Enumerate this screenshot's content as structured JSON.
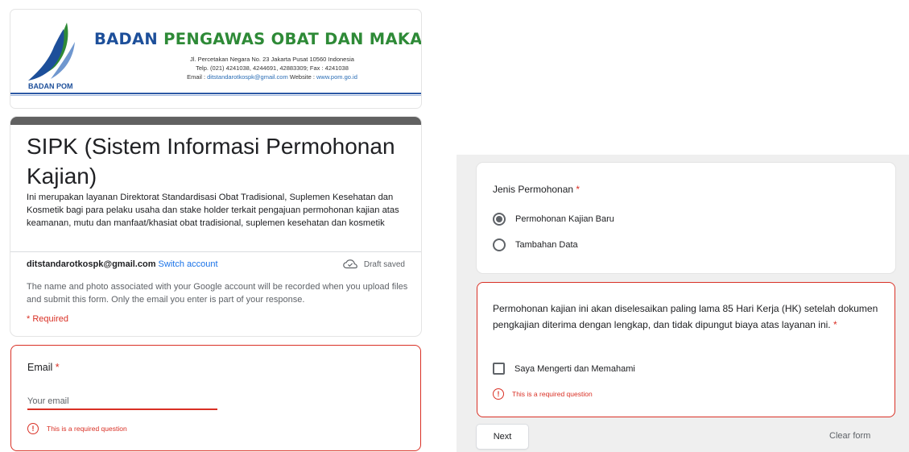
{
  "header": {
    "logo_label": "BADAN POM",
    "org_name_part1": "BADAN",
    "org_name_part2": "PENGAWAS OBAT DAN MAKANAN",
    "address_line1": "Jl. Percetakan Negara No. 23 Jakarta Pusat 10560 Indonesia",
    "address_line2": "Telp. (021) 4241038, 4244691, 42883309; Fax : 4241038",
    "address_email_label": "Email : ",
    "address_email": "ditstandarotkospk@gmail.com",
    "address_web_label": " Website : ",
    "address_web": "www.pom.go.id",
    "colors": {
      "blue": "#1d4f9a",
      "green": "#2e8a37"
    }
  },
  "form": {
    "title": "SIPK (Sistem Informasi Permohonan Kajian)",
    "description": "Ini merupakan layanan Direktorat Standardisasi Obat Tradisional, Suplemen Kesehatan dan Kosmetik bagi para pelaku usaha dan stake holder terkait pengajuan permohonan kajian atas keamanan, mutu dan manfaat/khasiat obat tradisional, suplemen kesehatan dan kosmetik",
    "account_email": "ditstandarotkospk@gmail.com",
    "switch_account": "Switch account",
    "draft_status": "Draft saved",
    "notice": "The name and photo associated with your Google account will be recorded when you upload files and submit this form. Only the email you enter is part of your response.",
    "required_note": "* Required"
  },
  "email_question": {
    "label": "Email",
    "required_mark": "*",
    "placeholder": "Your email",
    "value": "",
    "error": "This is a required question"
  },
  "jenis_question": {
    "label": "Jenis Permohonan",
    "required_mark": "*",
    "options": [
      {
        "label": "Permohonan Kajian Baru",
        "selected": true
      },
      {
        "label": "Tambahan Data",
        "selected": false
      }
    ]
  },
  "agree_question": {
    "text": "Permohonan kajian ini akan diselesaikan paling lama 85 Hari Kerja (HK) setelah dokumen pengkajian diterima dengan lengkap, dan tidak dipungut biaya atas layanan ini.",
    "required_mark": "*",
    "checkbox_label": "Saya Mengerti dan Memahami",
    "checked": false,
    "error": "This is a required question"
  },
  "actions": {
    "next": "Next",
    "clear": "Clear form"
  },
  "colors": {
    "error": "#d93025",
    "link": "#1a73e8",
    "title_bar": "#616161"
  }
}
